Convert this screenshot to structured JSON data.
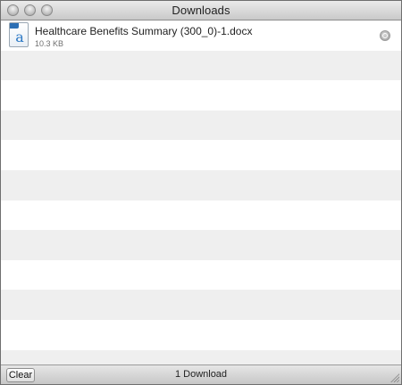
{
  "window": {
    "title": "Downloads"
  },
  "downloads": [
    {
      "filename": "Healthcare Benefits Summary (300_0)-1.docx",
      "size": "10.3 KB",
      "icon": "docx-file-icon"
    }
  ],
  "footer": {
    "clear_label": "Clear",
    "status": "1 Download"
  }
}
